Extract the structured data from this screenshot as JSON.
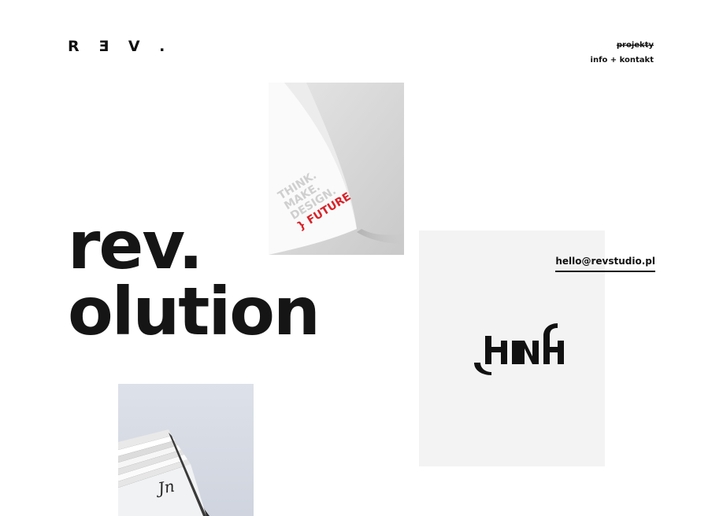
{
  "header": {
    "logo": "R Ǝ V .",
    "nav": [
      {
        "label": "projekty",
        "struck": true
      },
      {
        "label": "info + kontakt",
        "struck": false
      }
    ]
  },
  "hero": {
    "line1": "rev.",
    "line2": "olution"
  },
  "contact": {
    "email": "hello@revstudio.pl"
  },
  "paper_card": {
    "lines": [
      "THINK.",
      "MAKE.",
      "DESIGN.",
      "} FUTURE"
    ]
  },
  "business_card": {
    "monogram": "Jn"
  },
  "colors": {
    "text": "#141414",
    "accent_red": "#d8232a",
    "card_grey": "#f3f3f3"
  }
}
